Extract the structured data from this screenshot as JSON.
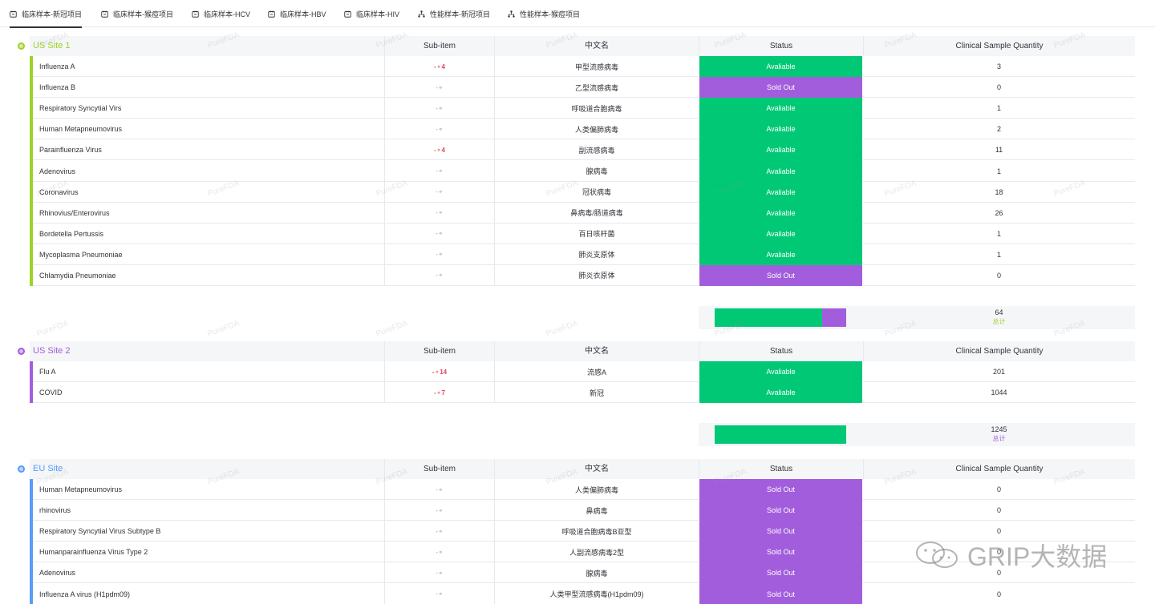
{
  "tabs": [
    {
      "label": "临床样本-新冠项目",
      "icon": "table-icon",
      "active": true
    },
    {
      "label": "临床样本-猴痘项目",
      "icon": "table-icon",
      "active": false
    },
    {
      "label": "临床样本-HCV",
      "icon": "table-icon",
      "active": false
    },
    {
      "label": "临床样本-HBV",
      "icon": "table-icon",
      "active": false
    },
    {
      "label": "临床样本-HIV",
      "icon": "table-icon",
      "active": false
    },
    {
      "label": "性能样本-新冠项目",
      "icon": "sitemap-icon",
      "active": false
    },
    {
      "label": "性能样本-猴痘项目",
      "icon": "sitemap-icon",
      "active": false
    }
  ],
  "columns": {
    "sub": "Sub-item",
    "cn": "中文名",
    "status": "Status",
    "qty": "Clinical Sample Quantity"
  },
  "colors": {
    "available": "#00c875",
    "sold_out": "#a25ddc",
    "site1": "#9cd326",
    "site2": "#a25ddc",
    "eu": "#579bfc",
    "subitem_active": "#e2445c"
  },
  "groups": [
    {
      "title": "US Site 1",
      "color": "#9cd326",
      "rows": [
        {
          "name": "Influenza A",
          "sub": "4",
          "cn": "甲型流感病毒",
          "status": "Avaliable",
          "qty": "3"
        },
        {
          "name": "Influenza B",
          "sub": "",
          "cn": "乙型流感病毒",
          "status": "Sold Out",
          "qty": "0"
        },
        {
          "name": "Respiratory Syncytial Virs",
          "sub": "",
          "cn": "呼吸道合胞病毒",
          "status": "Avaliable",
          "qty": "1"
        },
        {
          "name": "Human Metapneumovirus",
          "sub": "",
          "cn": "人类偏肺病毒",
          "status": "Avaliable",
          "qty": "2"
        },
        {
          "name": "Parainfluenza Virus",
          "sub": "4",
          "cn": "副流感病毒",
          "status": "Avaliable",
          "qty": "11"
        },
        {
          "name": "Adenovirus",
          "sub": "",
          "cn": "腺病毒",
          "status": "Avaliable",
          "qty": "1"
        },
        {
          "name": "Coronavirus",
          "sub": "",
          "cn": "冠状病毒",
          "status": "Avaliable",
          "qty": "18"
        },
        {
          "name": "Rhinovius/Enterovirus",
          "sub": "",
          "cn": "鼻病毒/肠道病毒",
          "status": "Avaliable",
          "qty": "26"
        },
        {
          "name": "Bordetella Pertussis",
          "sub": "",
          "cn": "百日咳杆菌",
          "status": "Avaliable",
          "qty": "1"
        },
        {
          "name": "Mycoplasma Pneumoniae",
          "sub": "",
          "cn": "肺炎支原体",
          "status": "Avaliable",
          "qty": "1"
        },
        {
          "name": "Chlamydia Pneumoniae",
          "sub": "",
          "cn": "肺炎衣原体",
          "status": "Sold Out",
          "qty": "0"
        }
      ],
      "summary": {
        "total": "64",
        "label": "总计",
        "available_fraction": 0.82,
        "sold_out_fraction": 0.18
      }
    },
    {
      "title": "US Site 2",
      "color": "#a25ddc",
      "rows": [
        {
          "name": "Flu A",
          "sub": "14",
          "cn": "流感A",
          "status": "Avaliable",
          "qty": "201"
        },
        {
          "name": "COVID",
          "sub": "7",
          "cn": "新冠",
          "status": "Avaliable",
          "qty": "1044"
        }
      ],
      "summary": {
        "total": "1245",
        "label": "总计",
        "available_fraction": 1.0,
        "sold_out_fraction": 0.0
      }
    },
    {
      "title": "EU Site",
      "color": "#579bfc",
      "rows": [
        {
          "name": "Human Metapneumovirus",
          "sub": "",
          "cn": "人类偏肺病毒",
          "status": "Sold Out",
          "qty": "0"
        },
        {
          "name": "rhinovirus",
          "sub": "",
          "cn": "鼻病毒",
          "status": "Sold Out",
          "qty": "0"
        },
        {
          "name": "Respiratory Syncytial Virus Subtype B",
          "sub": "",
          "cn": "呼吸道合胞病毒B亚型",
          "status": "Sold Out",
          "qty": "0"
        },
        {
          "name": "Humanparainfluenza Virus Type 2",
          "sub": "",
          "cn": "人副流感病毒2型",
          "status": "Sold Out",
          "qty": "0"
        },
        {
          "name": "Adenovirus",
          "sub": "",
          "cn": "腺病毒",
          "status": "Sold Out",
          "qty": "0"
        },
        {
          "name": "Influenza A virus (H1pdm09)",
          "sub": "",
          "cn": "人类甲型流感病毒(H1pdm09)",
          "status": "Sold Out",
          "qty": "0"
        }
      ]
    }
  ],
  "watermark": "PureFDA",
  "brand": "GRIP大数据"
}
